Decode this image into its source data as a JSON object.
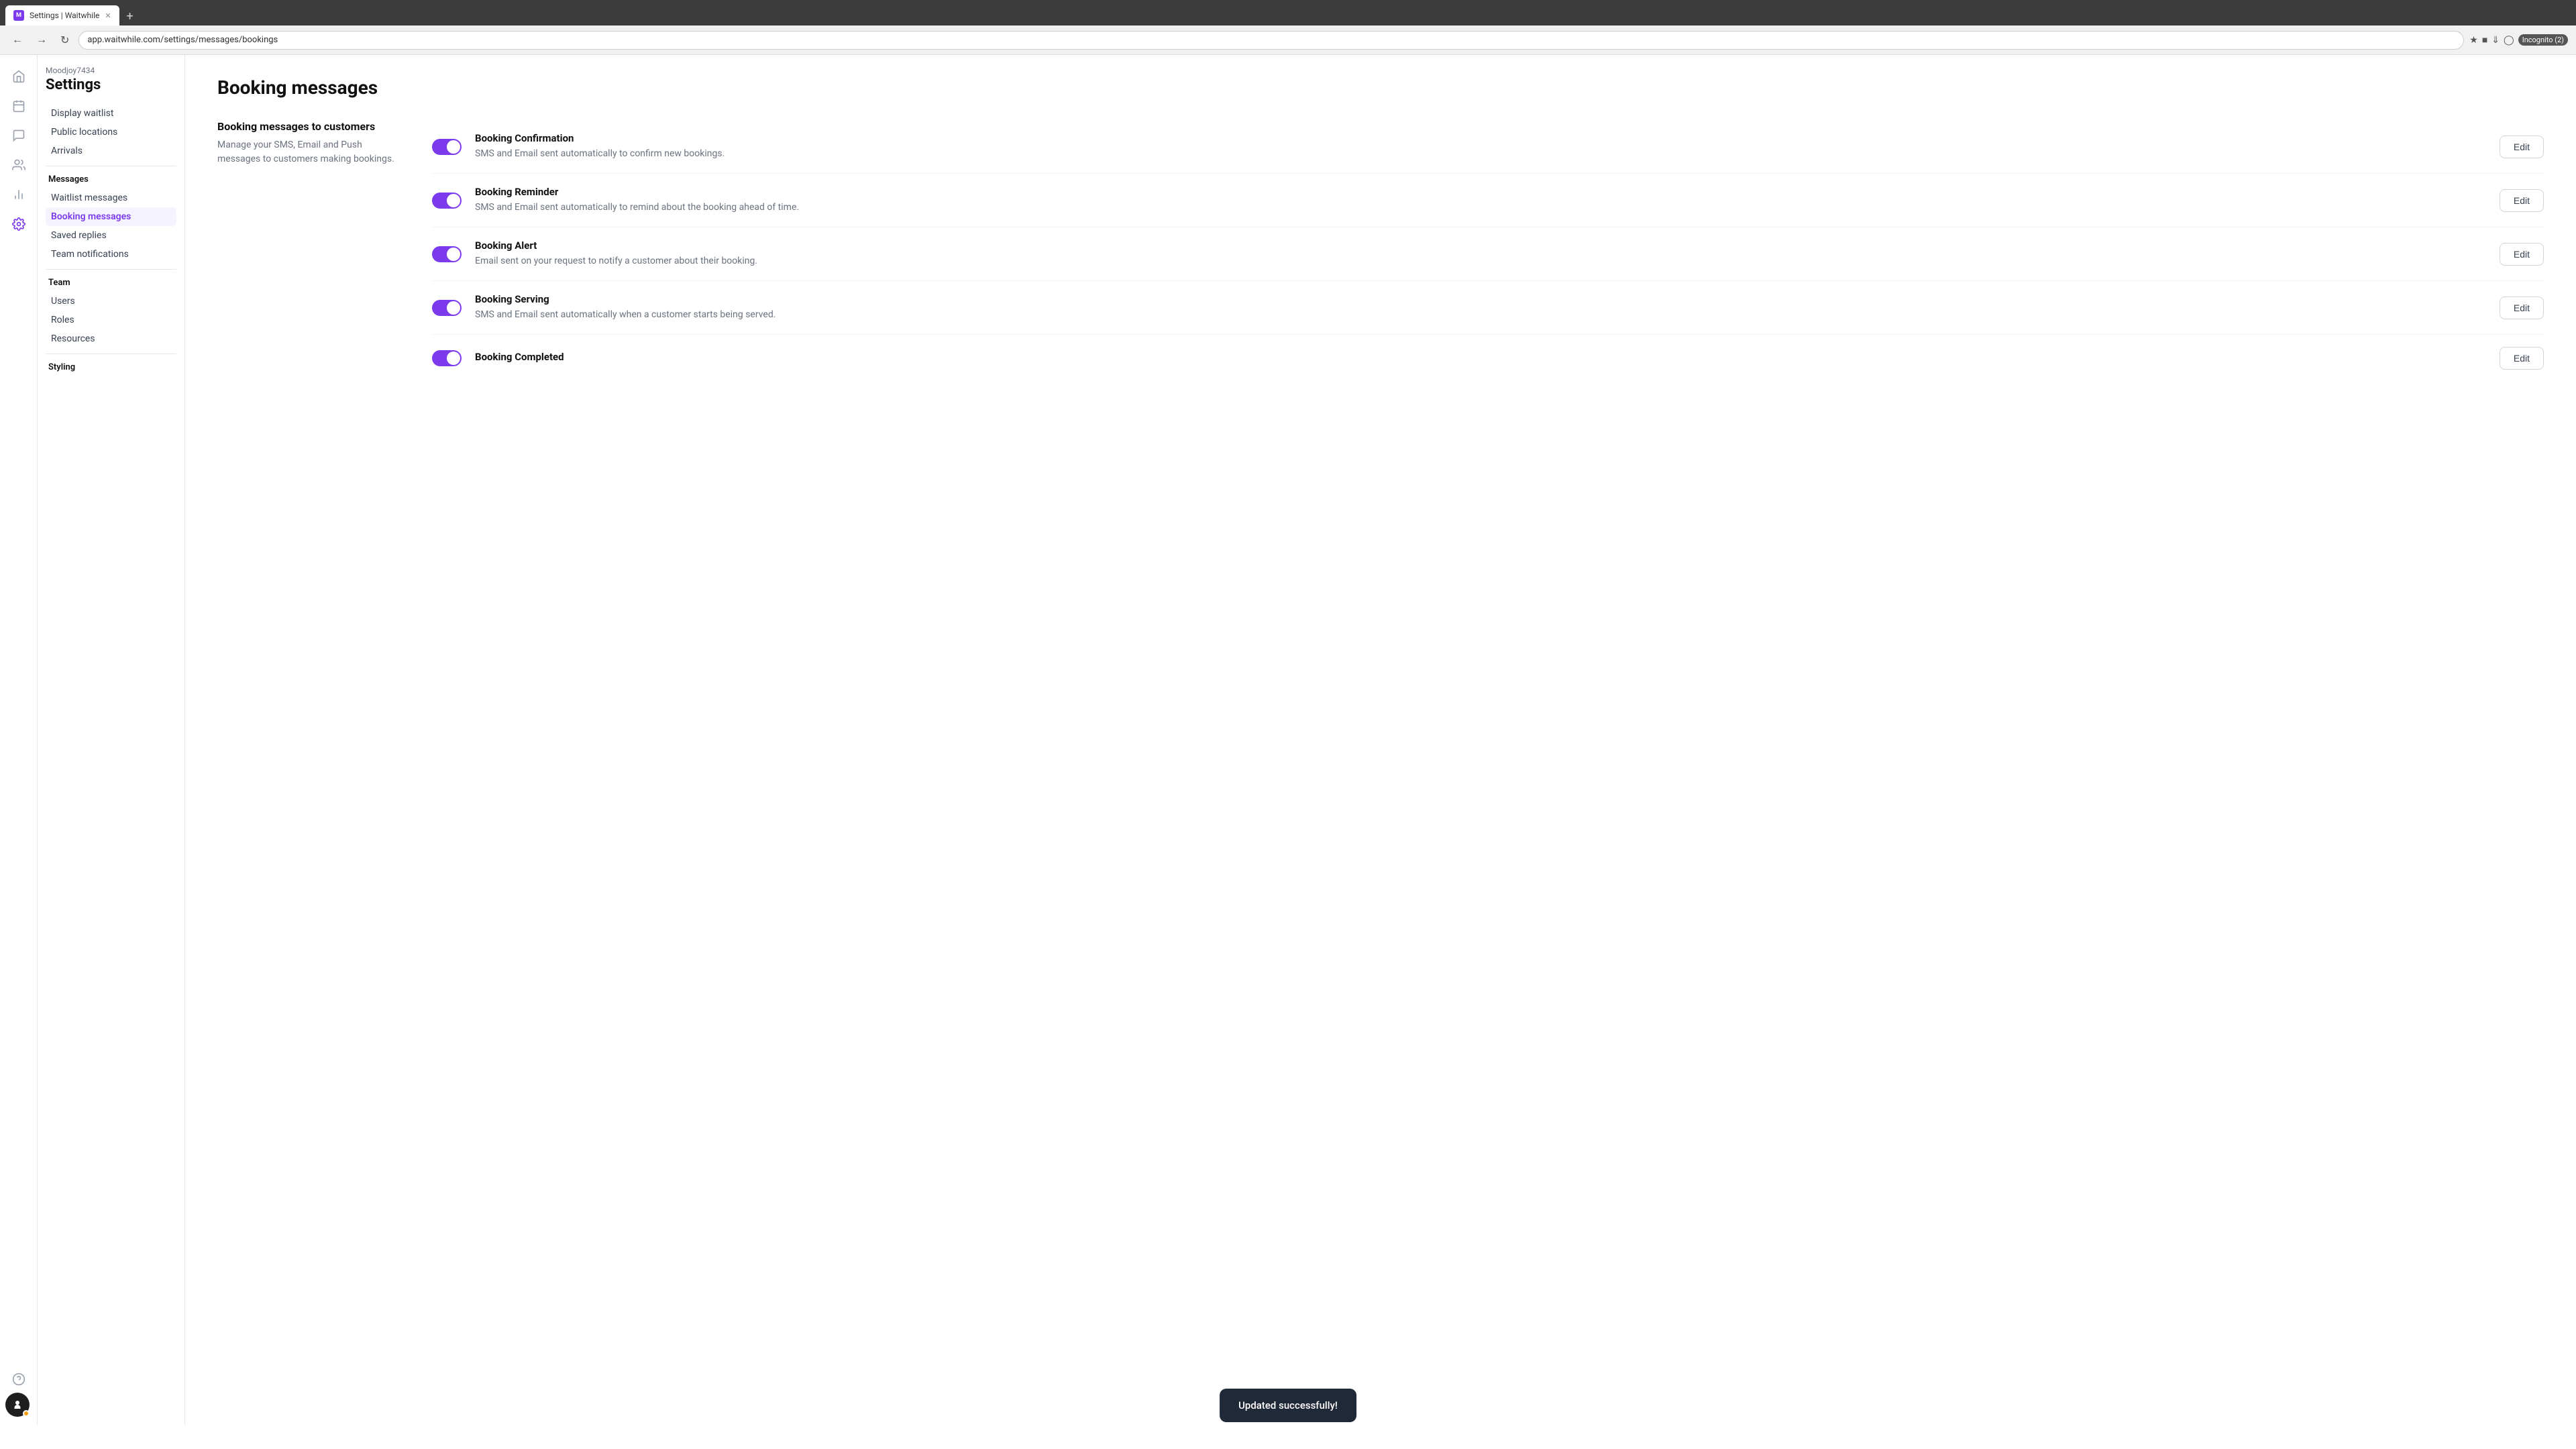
{
  "browser": {
    "url": "app.waitwhile.com/settings/messages/bookings",
    "tab_title": "Settings | Waitwhile",
    "incognito_label": "Incognito (2)"
  },
  "sidebar": {
    "account": "Moodjoy7434",
    "title": "Settings",
    "avatar_letter": "M",
    "nav_links_top": [
      {
        "label": "Display waitlist",
        "active": false
      },
      {
        "label": "Public locations",
        "active": false
      },
      {
        "label": "Arrivals",
        "active": false
      }
    ],
    "section_messages": "Messages",
    "nav_links_messages": [
      {
        "label": "Waitlist messages",
        "active": false
      },
      {
        "label": "Booking messages",
        "active": true
      },
      {
        "label": "Saved replies",
        "active": false
      },
      {
        "label": "Team notifications",
        "active": false
      }
    ],
    "section_team": "Team",
    "nav_links_team": [
      {
        "label": "Users",
        "active": false
      },
      {
        "label": "Roles",
        "active": false
      },
      {
        "label": "Resources",
        "active": false
      }
    ],
    "section_styling": "Styling"
  },
  "main": {
    "page_title": "Booking messages",
    "section_left_title": "Booking messages to customers",
    "section_left_desc": "Manage your SMS, Email and Push messages to customers making bookings.",
    "messages": [
      {
        "title": "Booking Confirmation",
        "desc": "SMS and Email sent automatically to confirm new bookings.",
        "enabled": true,
        "edit_label": "Edit"
      },
      {
        "title": "Booking Reminder",
        "desc": "SMS and Email sent automatically to remind about the booking ahead of time.",
        "enabled": true,
        "edit_label": "Edit"
      },
      {
        "title": "Booking Alert",
        "desc": "Email sent on your request to notify a customer about their booking.",
        "enabled": true,
        "edit_label": "Edit"
      },
      {
        "title": "Booking Serving",
        "desc": "SMS and Email sent automatically when a customer starts being served.",
        "enabled": true,
        "edit_label": "Edit"
      },
      {
        "title": "Booking Completed",
        "desc": "",
        "enabled": true,
        "edit_label": "Edit"
      }
    ]
  },
  "toast": {
    "message": "Updated successfully!"
  }
}
